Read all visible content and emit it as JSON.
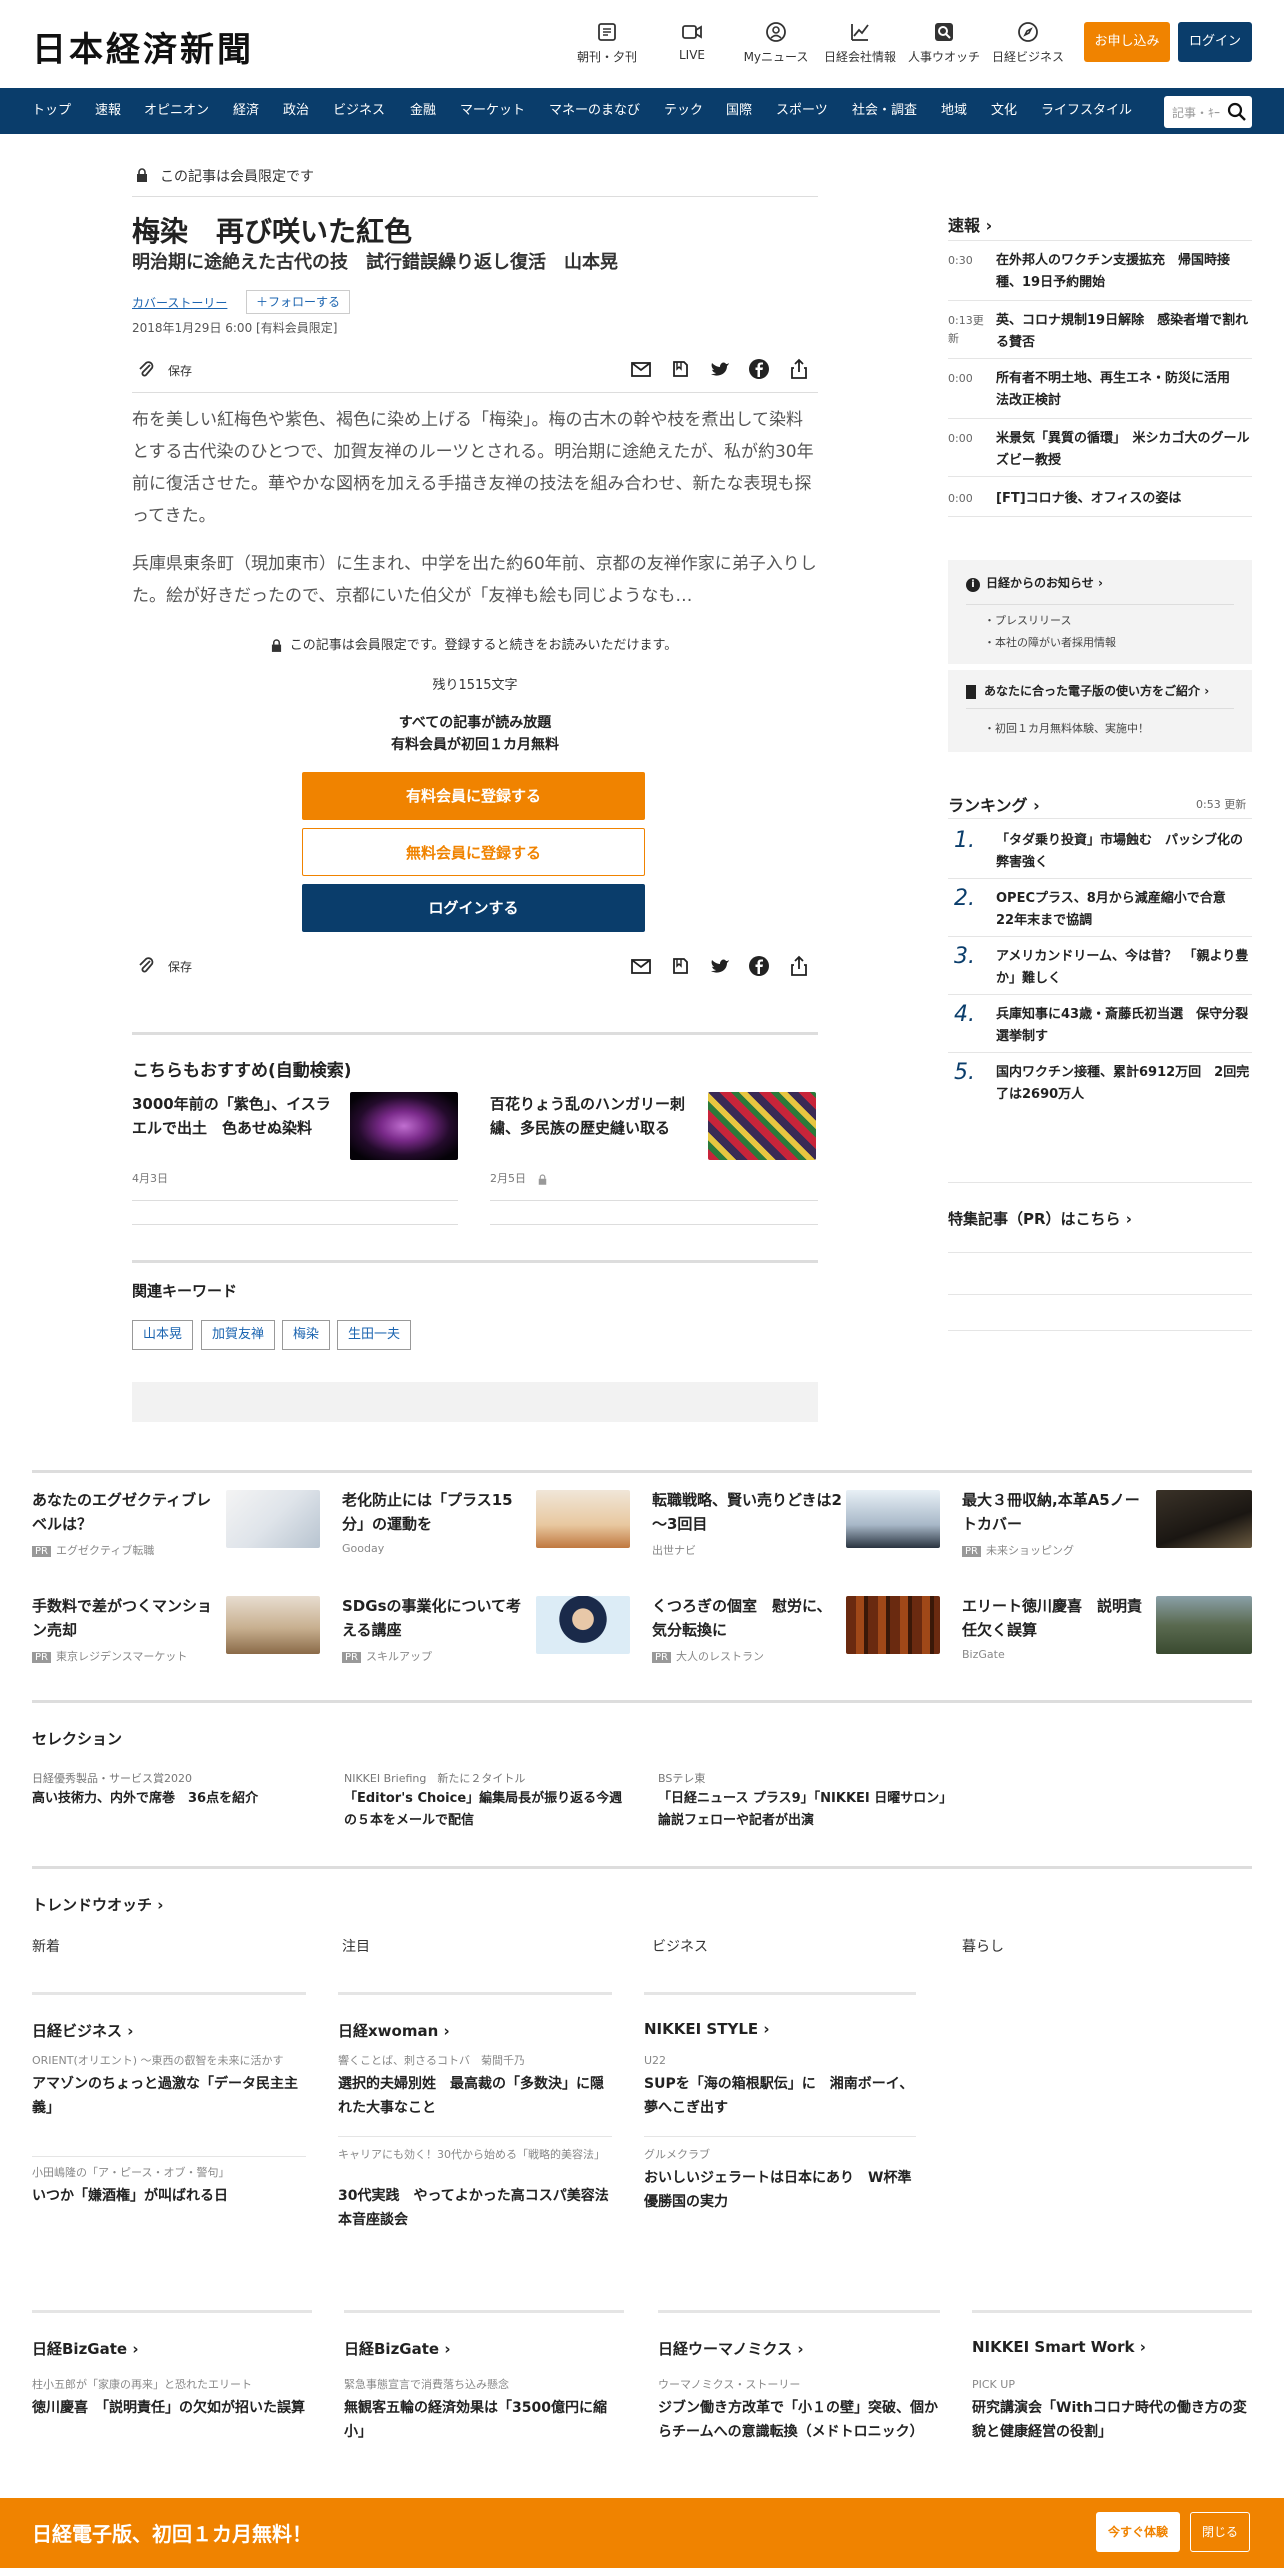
{
  "header": {
    "logo": "日本経済新聞",
    "nav": [
      {
        "label": "朝刊・夕刊",
        "icon": "newspaper-icon"
      },
      {
        "label": "LIVE",
        "icon": "video-icon"
      },
      {
        "label": "Myニュース",
        "icon": "user-icon"
      },
      {
        "label": "日経会社情報",
        "icon": "chart-icon"
      },
      {
        "label": "人事ウオッチ",
        "icon": "search-person-icon"
      },
      {
        "label": "日経ビジネス",
        "icon": "compass-icon"
      }
    ],
    "apply_label": "お申し込み",
    "login_label": "ログイン"
  },
  "global_nav": [
    "トップ",
    "速報",
    "オピニオン",
    "経済",
    "政治",
    "ビジネス",
    "金融",
    "マーケット",
    "マネーのまなび",
    "テック",
    "国際",
    "スポーツ",
    "社会・調査",
    "地域",
    "文化",
    "ライフスタイル"
  ],
  "search": {
    "placeholder": "記事・ｷｰ"
  },
  "article": {
    "member_only": "この記事は会員限定です",
    "title": "梅染　再び咲いた紅色",
    "subtitle": "明治期に途絶えた古代の技　試行錯誤繰り返し復活　山本晃",
    "category": "カバーストーリー",
    "follow": "フォローする",
    "date": "2018年1月29日 6:00 [有料会員限定]",
    "save": "保存",
    "para1": "布を美しい紅梅色や紫色、褐色に染め上げる「梅染」。梅の古木の幹や枝を煮出して染料とする古代染のひとつで、加賀友禅のルーツとされる。明治期に途絶えたが、私が約30年前に復活させた。華やかな図柄を加える手描き友禅の技法を組み合わせ、新たな表現も探ってきた。",
    "para2": "兵庫県東条町（現加東市）に生まれ、中学を出た約60年前、京都の友禅作家に弟子入りした。絵が好きだったので、京都にいた伯父が「友禅も絵も同じようなも…",
    "member_note": "この記事は会員限定です。登録すると続きをお読みいただけます。",
    "remaining": "残り1515文字",
    "all_read": "すべての記事が読み放題",
    "first_month": "有料会員が初回１カ月無料",
    "cta_paid": "有料会員に登録する",
    "cta_free": "無料会員に登録する",
    "cta_login": "ログインする"
  },
  "recommend": {
    "heading": "こちらもおすすめ(自動検索)",
    "items": [
      {
        "title": "3000年前の「紫色」、イスラエルで出土　色あせぬ染料",
        "date": "4月3日"
      },
      {
        "title": "百花りょう乱のハンガリー刺繍、多民族の歴史縫い取る",
        "date": "2月5日"
      }
    ]
  },
  "keywords": {
    "heading": "関連キーワード",
    "items": [
      "山本晃",
      "加賀友禅",
      "梅染",
      "生田一夫"
    ]
  },
  "sidebar": {
    "breaking_heading": "速報",
    "breaking": [
      {
        "time": "0:30",
        "title": "在外邦人のワクチン支援拡充　帰国時接種、19日予約開始"
      },
      {
        "time": "0:13更新",
        "title": "英、コロナ規制19日解除　感染者増で割れる賛否"
      },
      {
        "time": "0:00",
        "title": "所有者不明土地、再生エネ・防災に活用　法改正検討"
      },
      {
        "time": "0:00",
        "title": "米景気「異質の循環」　米シカゴ大のグールズビー教授"
      },
      {
        "time": "0:00",
        "title": "[FT]コロナ後、オフィスの姿は"
      }
    ],
    "notice_heading": "日経からのお知らせ",
    "notice_items": [
      "プレスリリース",
      "本社の障がい者採用情報"
    ],
    "guide_heading": "あなたに合った電子版の使い方をご紹介",
    "guide_items": [
      "初回１カ月無料体験、実施中！"
    ],
    "ranking_heading": "ランキング",
    "ranking_updated": "0:53  更新",
    "ranking": [
      {
        "no": "1.",
        "title": "「タダ乗り投資」市場蝕む　パッシブ化の弊害強く"
      },
      {
        "no": "2.",
        "title": "OPECプラス、8月から減産縮小で合意　22年末まで協調"
      },
      {
        "no": "3.",
        "title": "アメリカンドリーム、今は昔？　「親より豊か」難しく"
      },
      {
        "no": "4.",
        "title": "兵庫知事に43歳・斎藤氏初当選　保守分裂選挙制す"
      },
      {
        "no": "5.",
        "title": "国内ワクチン接種、累計6912万回　2回完了は2690万人"
      }
    ],
    "pr_link": "特集記事（PR）はこちら"
  },
  "pr": [
    {
      "title": "あなたのエグゼクティブレベルは？",
      "source": "エグゼクティブ転職",
      "pr": true
    },
    {
      "title": "老化防止には「プラス15分」の運動を",
      "source": "Gooday",
      "pr": false
    },
    {
      "title": "転職戦略、賢い売りどきは2～3回目",
      "source": "出世ナビ",
      "pr": false
    },
    {
      "title": "最大３冊収納,本革A5ノートカバー",
      "source": "未来ショッピング",
      "pr": true
    },
    {
      "title": "手数料で差がつくマンション売却",
      "source": "東京レジデンスマーケット",
      "pr": true
    },
    {
      "title": "SDGsの事業化について考える講座",
      "source": "スキルアップ",
      "pr": true
    },
    {
      "title": "くつろぎの個室　慰労に、気分転換に",
      "source": "大人のレストラン",
      "pr": true
    },
    {
      "title": "エリート徳川慶喜　説明責任欠く誤算",
      "source": "BizGate",
      "pr": false
    }
  ],
  "pr_label": "PR",
  "selection": {
    "heading": "セレクション",
    "items": [
      {
        "source": "日経優秀製品・サービス賞2020",
        "title": "高い技術力、内外で席巻　36点を紹介"
      },
      {
        "source": "NIKKEI Briefing　新たに２タイトル",
        "title": "「Editor's Choice」編集局長が振り返る今週の５本をメールで配信"
      },
      {
        "source": "BSテレ東",
        "title": "「日経ニュース プラス9」「NIKKEI 日曜サロン」論説フェローや記者が出演"
      }
    ]
  },
  "trend": {
    "heading": "トレンドウオッチ",
    "columns": [
      "新着",
      "注目",
      "ビジネス",
      "暮らし"
    ]
  },
  "media1": [
    {
      "heading": "日経ビジネス",
      "items": [
        {
          "source": "ORIENT(オリエント) ～東西の叡智を未来に活かす",
          "title": "アマゾンのちょっと過激な「データ民主主義」"
        },
        {
          "source": "小田嶋隆の「ア・ピース・オブ・警句」",
          "title": "いつか「嫌酒権」が叫ばれる日"
        }
      ]
    },
    {
      "heading": "日経xwoman",
      "items": [
        {
          "source": "響くことば、刺さるコトバ　菊間千乃",
          "title": "選択的夫婦別姓　最高裁の「多数決」に隠れた大事なこと"
        },
        {
          "source": "キャリアにも効く！30代から始める「戦略的美容法」",
          "title": "30代実践　やってよかった高コスパ美容法　本音座談会"
        }
      ]
    },
    {
      "heading": "NIKKEI STYLE",
      "items": [
        {
          "source": "U22",
          "title": "SUPを「海の箱根駅伝」に　湘南ボーイ、夢へこぎ出す"
        },
        {
          "source": "グルメクラブ",
          "title": "おいしいジェラートは日本にあり　W杯準優勝国の実力"
        }
      ]
    }
  ],
  "media2": [
    {
      "heading": "日経BizGate",
      "source": "柱小五郎が「家康の再来」と恐れたエリート",
      "title": "徳川慶喜　「説明責任」の欠如が招いた誤算"
    },
    {
      "heading": "日経BizGate",
      "source": "緊急事態宣言で消費落ち込み懸念",
      "title": "無観客五輪の経済効果は「3500億円に縮小」"
    },
    {
      "heading": "日経ウーマノミクス",
      "source": "ウーマノミクス・ストーリー",
      "title": "ジブン働き方改革で「小１の壁」突破、個からチームへの意識転換（メドトロニック）"
    },
    {
      "heading": "NIKKEI Smart Work",
      "source": "PICK UP",
      "title": "研究講演会「Withコロナ時代の働き方の変貌と健康経営の役割」"
    }
  ],
  "bottom_bar": {
    "message": "日経電子版、初回１カ月無料！",
    "trial": "今すぐ体験",
    "close": "閉じる"
  },
  "colors": {
    "navy": "#0a3d6b",
    "orange": "#f08300",
    "link": "#1b64b0"
  }
}
